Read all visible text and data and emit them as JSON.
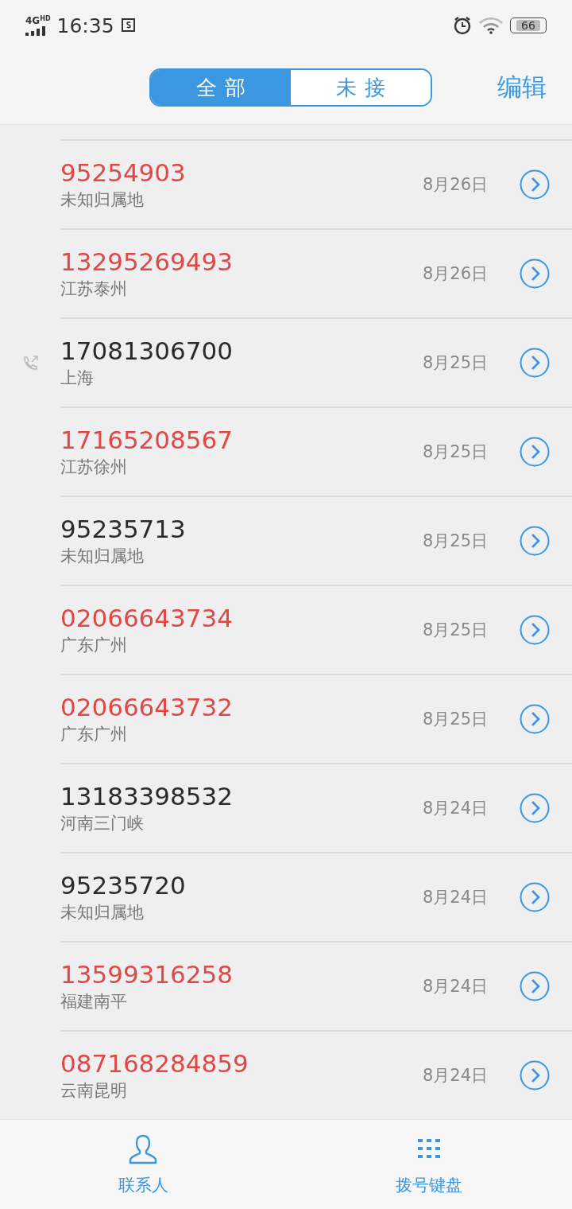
{
  "status_bar": {
    "network": "4G",
    "network_badge": "HD",
    "time": "16:35",
    "battery": "66"
  },
  "header": {
    "tabs": [
      {
        "label": "全部",
        "selected": true
      },
      {
        "label": "未接",
        "selected": false
      }
    ],
    "edit_label": "编辑"
  },
  "calls": [
    {
      "number": "95254903",
      "location": "未知归属地",
      "date": "8月26日",
      "kind": "missed"
    },
    {
      "number": "13295269493",
      "location": "江苏泰州",
      "date": "8月26日",
      "kind": "missed"
    },
    {
      "number": "17081306700",
      "location": "上海",
      "date": "8月25日",
      "kind": "outgoing"
    },
    {
      "number": "17165208567",
      "location": "江苏徐州",
      "date": "8月25日",
      "kind": "missed"
    },
    {
      "number": "95235713",
      "location": "未知归属地",
      "date": "8月25日",
      "kind": "incoming"
    },
    {
      "number": "02066643734",
      "location": "广东广州",
      "date": "8月25日",
      "kind": "missed"
    },
    {
      "number": "02066643732",
      "location": "广东广州",
      "date": "8月25日",
      "kind": "missed"
    },
    {
      "number": "13183398532",
      "location": "河南三门峡",
      "date": "8月24日",
      "kind": "incoming"
    },
    {
      "number": "95235720",
      "location": "未知归属地",
      "date": "8月24日",
      "kind": "incoming"
    },
    {
      "number": "13599316258",
      "location": "福建南平",
      "date": "8月24日",
      "kind": "missed"
    },
    {
      "number": "087168284859",
      "location": "云南昆明",
      "date": "8月24日",
      "kind": "missed"
    }
  ],
  "bottom_nav": [
    {
      "label": "联系人",
      "kind": "contacts"
    },
    {
      "label": "拨号键盘",
      "kind": "keypad"
    }
  ]
}
